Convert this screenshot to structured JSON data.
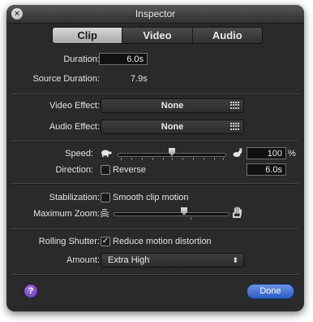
{
  "window": {
    "title": "Inspector"
  },
  "tabs": [
    {
      "label": "Clip",
      "active": true
    },
    {
      "label": "Video",
      "active": false
    },
    {
      "label": "Audio",
      "active": false
    }
  ],
  "clip": {
    "duration_label": "Duration:",
    "duration_value": "6.0s",
    "source_duration_label": "Source Duration:",
    "source_duration_value": "7.9s"
  },
  "effects": {
    "video_label": "Video Effect:",
    "video_value": "None",
    "audio_label": "Audio Effect:",
    "audio_value": "None"
  },
  "speed": {
    "label": "Speed:",
    "percent_value": "100",
    "percent_unit": "%",
    "slider_fraction": 0.5,
    "direction_label": "Direction:",
    "reverse_label": "Reverse",
    "reverse_checked": false,
    "direction_value": "6.0s"
  },
  "stabilization": {
    "label": "Stabilization:",
    "smooth_label": "Smooth clip motion",
    "smooth_checked": false,
    "max_zoom_label": "Maximum Zoom:",
    "zoom_slider_fraction": 0.6
  },
  "rolling_shutter": {
    "label": "Rolling Shutter:",
    "reduce_label": "Reduce motion distortion",
    "reduce_checked": true,
    "amount_label": "Amount:",
    "amount_value": "Extra High"
  },
  "footer": {
    "help_symbol": "?",
    "done_label": "Done"
  },
  "colors": {
    "accent_done": "#2b5bc4",
    "help_purple": "#5b2fa3",
    "panel_bg": "#2a2a2a"
  }
}
